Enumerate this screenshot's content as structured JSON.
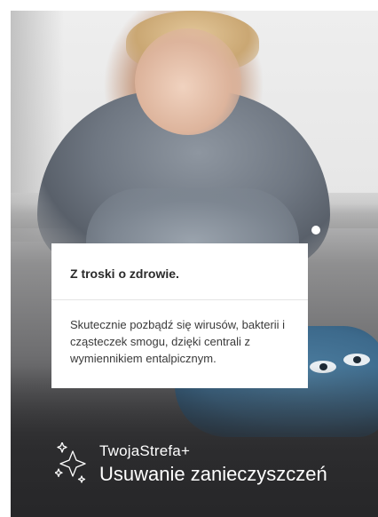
{
  "card": {
    "title": "Z troski o zdrowie.",
    "body": "Skutecznie pozbądź się wirusów, bakterii i cząsteczek smogu, dzięki centrali z wymiennikiem entalpicznym."
  },
  "brand": {
    "name": "TwojaStrefa+",
    "headline": "Usuwanie zanieczyszczeń",
    "icon": "sparkle-icon"
  },
  "colors": {
    "text_on_dark": "#ffffff",
    "box_background": "#ffffff",
    "title_text": "#2a2a2a"
  }
}
